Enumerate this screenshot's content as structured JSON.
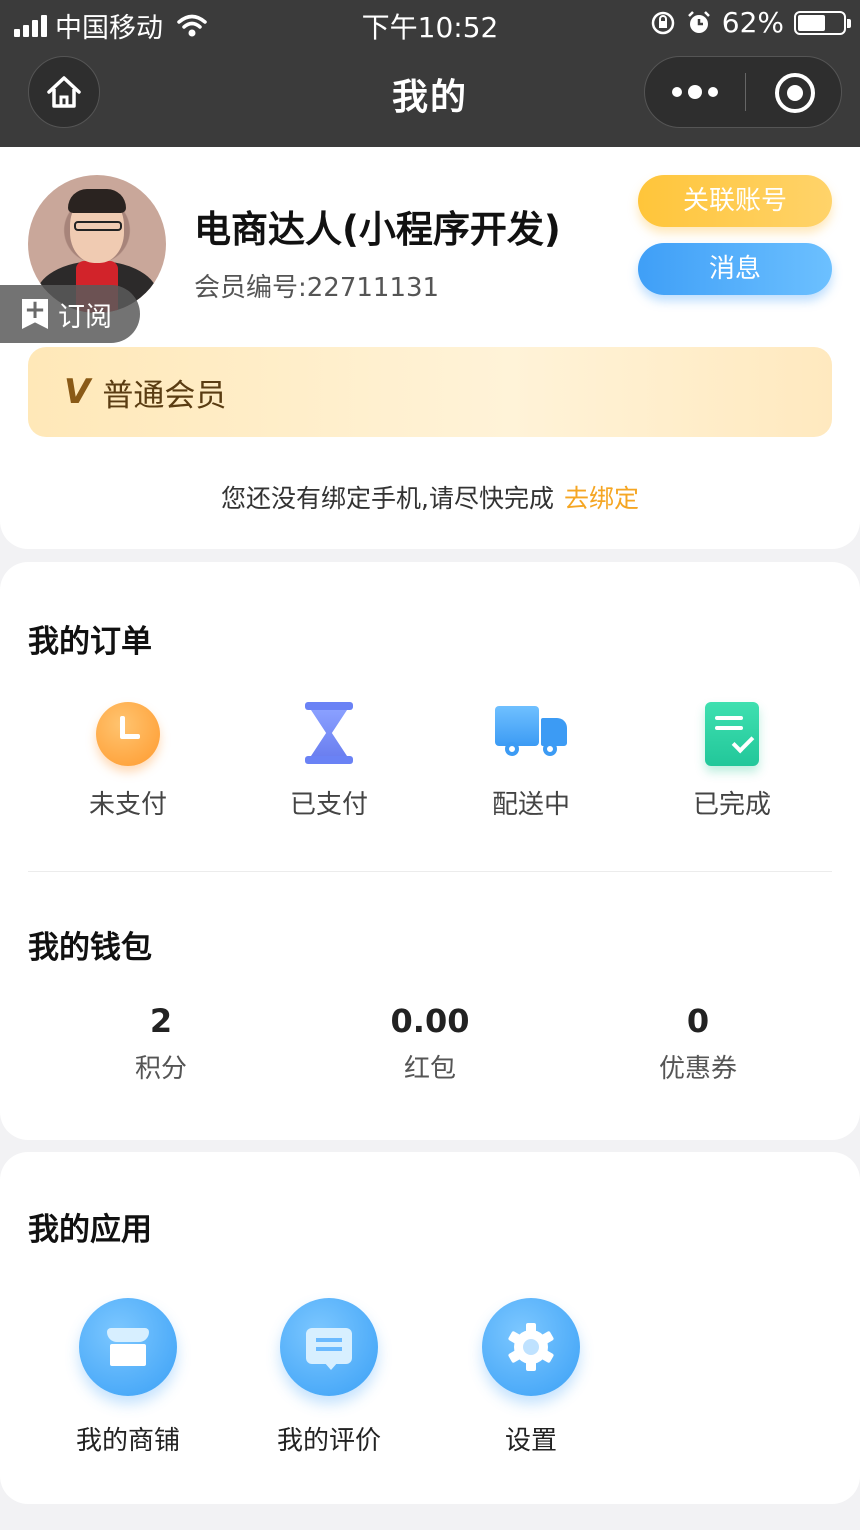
{
  "status_bar": {
    "carrier": "中国移动",
    "time": "下午10:52",
    "battery": "62%",
    "battery_level": 0.62
  },
  "nav": {
    "title": "我的"
  },
  "profile": {
    "name": "电商达人(小程序开发)",
    "member_no": "会员编号:22711131",
    "subscribe": "订阅",
    "link_account": "关联账号",
    "messages": "消息",
    "vip_badge": "V",
    "vip_level": "普通会员",
    "bind_tip": "您还没有绑定手机,请尽快完成",
    "bind_link": "去绑定"
  },
  "orders": {
    "title": "我的订单",
    "items": [
      {
        "label": "未支付",
        "icon": "clock-icon"
      },
      {
        "label": "已支付",
        "icon": "hourglass-icon"
      },
      {
        "label": "配送中",
        "icon": "truck-icon"
      },
      {
        "label": "已完成",
        "icon": "checklist-icon"
      }
    ]
  },
  "wallet": {
    "title": "我的钱包",
    "items": [
      {
        "value": "2",
        "label": "积分"
      },
      {
        "value": "0.00",
        "label": "红包"
      },
      {
        "value": "0",
        "label": "优惠券"
      }
    ]
  },
  "apps": {
    "title": "我的应用",
    "items": [
      {
        "label": "我的商铺",
        "icon": "store-icon"
      },
      {
        "label": "我的评价",
        "icon": "comment-icon"
      },
      {
        "label": "设置",
        "icon": "gear-icon"
      }
    ]
  },
  "colors": {
    "nav_bg": "#3b3b3b",
    "link_account": "#ffc53a",
    "messages": "#3f9ff7",
    "bind_link": "#f5a623",
    "vip_bg": "#ffe8b8"
  }
}
